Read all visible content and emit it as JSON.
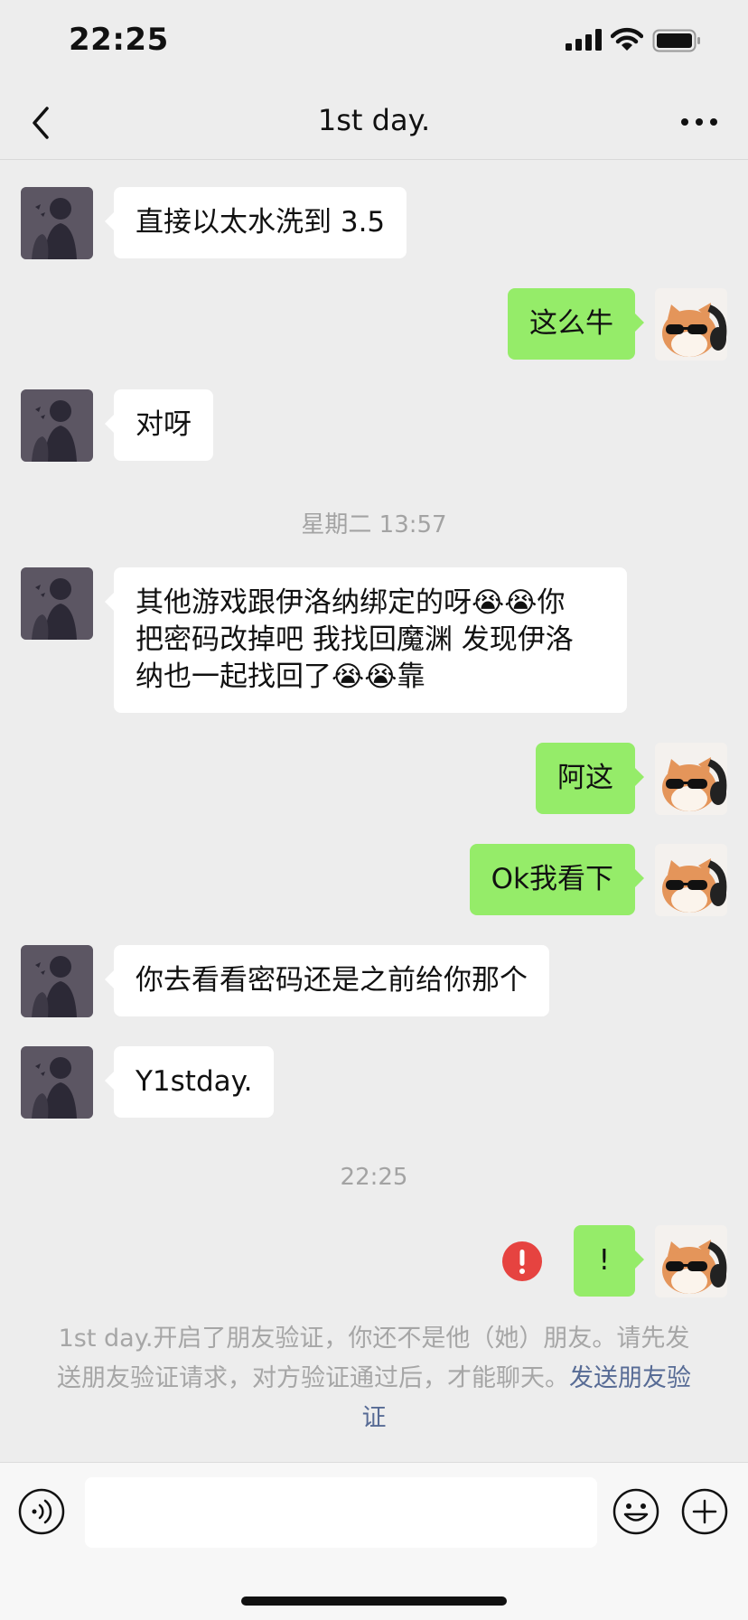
{
  "status_bar": {
    "time": "22:25"
  },
  "nav": {
    "title": "1st day.",
    "back_icon": "chevron-left-icon",
    "more_icon": "ellipsis-icon"
  },
  "messages": [
    {
      "side": "in",
      "text": "直接以太水洗到 3.5"
    },
    {
      "side": "out",
      "text": "这么牛"
    },
    {
      "side": "in",
      "text": "对呀"
    },
    {
      "side": "in",
      "lines": [
        "其他游戏跟伊洛纳绑定的呀😭😭你",
        "把密码改掉吧 我找回魔渊 发现伊洛",
        "纳也一起找回了😭😭靠"
      ]
    },
    {
      "side": "out",
      "text": "阿这"
    },
    {
      "side": "out",
      "text": "Ok我看下"
    },
    {
      "side": "in",
      "text": "你去看看密码还是之前给你那个"
    },
    {
      "side": "in",
      "text": "Y1stday."
    },
    {
      "side": "out",
      "text": "!",
      "status": "failed"
    }
  ],
  "timestamps": [
    "星期二 13:57",
    "22:25"
  ],
  "notice": {
    "text": "1st day.开启了朋友验证，你还不是他（她）朋友。请先发送朋友验证请求，对方验证通过后，才能聊天。",
    "link": "发送朋友验证"
  },
  "input_bar": {
    "value": "",
    "icons": [
      "voice-icon",
      "emoji-icon",
      "plus-icon"
    ]
  },
  "colors": {
    "background": "#ededed",
    "outgoing_bubble": "#95ec69",
    "incoming_bubble": "#ffffff",
    "link": "#576b95",
    "error": "#e64340"
  }
}
